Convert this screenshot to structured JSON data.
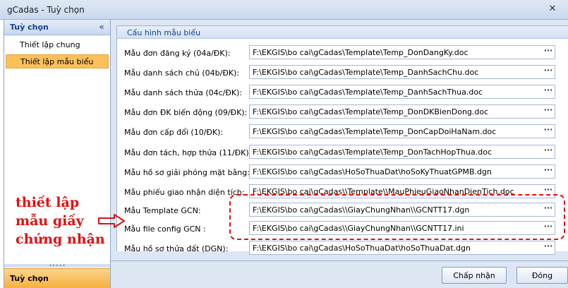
{
  "window": {
    "title": "gCadas - Tuỳ chọn",
    "close_glyph": "✕"
  },
  "sidebar": {
    "header": "Tuỳ chọn",
    "collapse_glyph": "«",
    "items": [
      {
        "label": "Thiết lập chung"
      },
      {
        "label": "Thiết lập mẫu biểu"
      }
    ],
    "grip": "•••••",
    "footer": "Tuỳ chọn"
  },
  "group": {
    "title": "Cấu hình mẫu biểu"
  },
  "rows": [
    {
      "label": "Mẫu đơn đăng ký (04a/ĐK):",
      "path": "F:\\EKGIS\\bo cai\\gCadas\\Template\\Temp_DonDangKy.doc"
    },
    {
      "label": "Mẫu danh sách chủ (04b/ĐK):",
      "path": "F:\\EKGIS\\bo cai\\gCadas\\Template\\Temp_DanhSachChu.doc"
    },
    {
      "label": "Mẫu danh sách thửa (04c/ĐK):",
      "path": "F:\\EKGIS\\bo cai\\gCadas\\Template\\Temp_DanhSachThua.doc"
    },
    {
      "label": "Mẫu đơn ĐK biến động (09/ĐK):",
      "path": "F:\\EKGIS\\bo cai\\gCadas\\Template\\Temp_DonDKBienDong.doc"
    },
    {
      "label": "Mẫu đơn cấp đổi (10/ĐK):",
      "path": "F:\\EKGIS\\bo cai\\gCadas\\Template\\Temp_DonCapDoiHaNam.doc"
    },
    {
      "label": "Mẫu đơn tách, hợp thửa (11/ĐK):",
      "path": "F:\\EKGIS\\bo cai\\gCadas\\Template\\Temp_DonTachHopThua.doc"
    },
    {
      "label": "Mẫu hồ sơ giải phóng mặt bằng:",
      "path": "F:\\EKGIS\\bo cai\\gCadas\\HoSoThuaDat\\hoSoKyThuatGPMB.dgn"
    },
    {
      "label": "Mẫu phiếu giao nhận diện tích:",
      "path": "F:\\EKGIS\\bo cai\\gCadas\\\\Template\\\\MauPhieuGiaoNhanDienTich.doc"
    },
    {
      "label": "Mẫu Template GCN:",
      "path": "F:\\EKGIS\\bo cai\\gCadas\\\\GiayChungNhan\\\\GCNTT17.dgn"
    },
    {
      "label": "Mẫu file config GCN :",
      "path": "F:\\EKGIS\\bo cai\\gCadas\\\\GiayChungNhan\\\\GCNTT17.ini"
    },
    {
      "label": "Mẫu hồ sơ thửa đất (DGN):",
      "path": "F:\\EKGIS\\bo cai\\gCadas\\HoSoThuaDat\\hoSoThuaDat.dgn"
    }
  ],
  "browse_glyph": "···",
  "buttons": {
    "ok": "Chấp nhận",
    "close": "Đóng"
  },
  "annotation": {
    "lines": [
      "thiết lập",
      "mẫu giấy",
      "chứng nhận"
    ],
    "color": "#e01010"
  }
}
